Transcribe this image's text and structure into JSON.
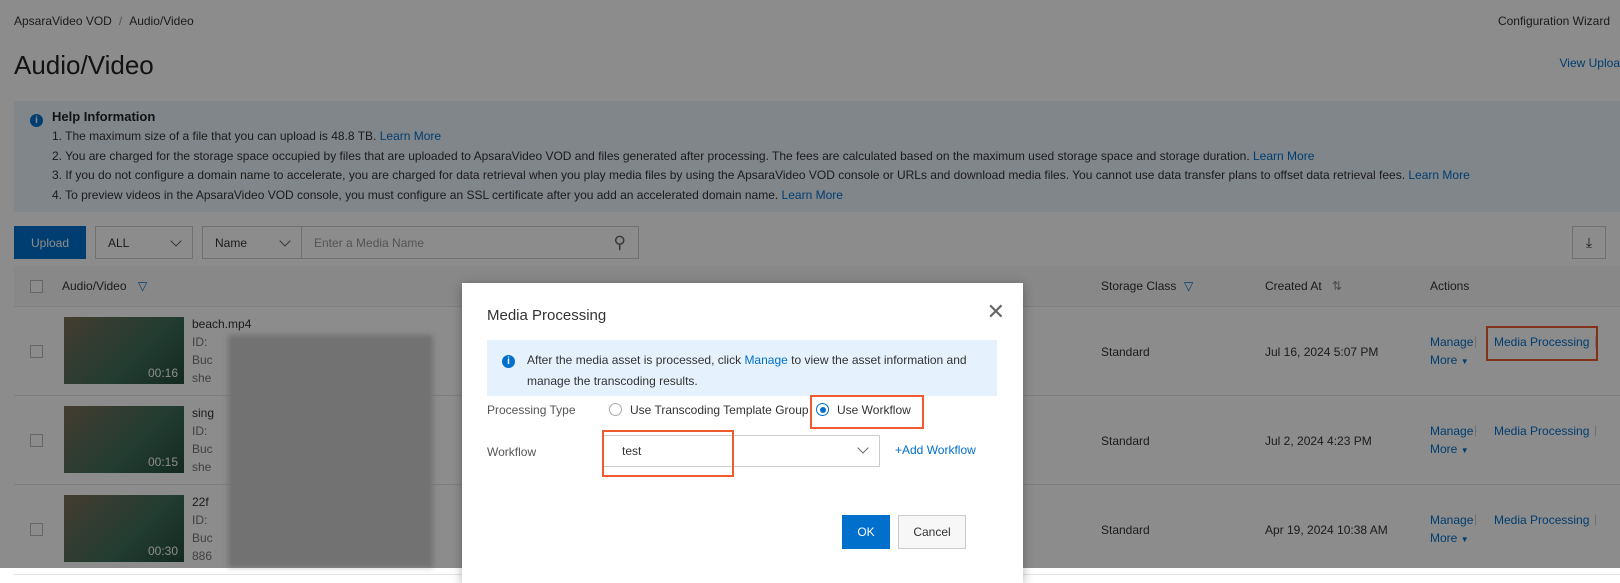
{
  "breadcrumb": [
    "ApsaraVideo VOD",
    "Audio/Video"
  ],
  "header": {
    "title": "Audio/Video",
    "config_wizard": "Configuration Wizard",
    "view_upload": "View Uploa"
  },
  "help": {
    "title": "Help Information",
    "items": [
      {
        "text": "1. The maximum size of a file that you can upload is 48.8 TB. ",
        "link": "Learn More"
      },
      {
        "text": "2. You are charged for the storage space occupied by files that are uploaded to ApsaraVideo VOD and files generated after processing. The fees are calculated based on the maximum used storage space and storage duration. ",
        "link": "Learn More"
      },
      {
        "text": "3. If you do not configure a domain name to accelerate, you are charged for data retrieval when you play media files by using the ApsaraVideo VOD console or URLs and download media files. You cannot use data transfer plans to offset data retrieval fees. ",
        "link": "Learn More"
      },
      {
        "text": "4. To preview videos in the ApsaraVideo VOD console, you must configure an SSL certificate after you add an accelerated domain name. ",
        "link": "Learn More"
      }
    ]
  },
  "toolbar": {
    "upload": "Upload",
    "filter": "ALL",
    "search_field": "Name",
    "search_placeholder": "Enter a Media Name"
  },
  "table": {
    "headers": {
      "media": "Audio/Video",
      "storage": "Storage Class",
      "created": "Created At",
      "actions": "Actions"
    },
    "rows": [
      {
        "name": "beach.mp4",
        "id": "ID:",
        "bucket": "Buc",
        "region": "she",
        "duration": "00:16",
        "storage": "Standard",
        "created": "Jul 16, 2024 5:07 PM",
        "manage": "Manage",
        "more": "More",
        "process": "Media Processing"
      },
      {
        "name": "sing",
        "id": "ID:",
        "bucket": "Buc",
        "region": "she",
        "duration": "00:15",
        "storage": "Standard",
        "created": "Jul 2, 2024 4:23 PM",
        "manage": "Manage",
        "more": "More",
        "process": "Media Processing"
      },
      {
        "name": "22f",
        "id": "ID:",
        "bucket": "Buc",
        "region": "886",
        "duration": "00:30",
        "storage": "Standard",
        "created": "Apr 19, 2024 10:38 AM",
        "manage": "Manage",
        "more": "More",
        "process": "Media Processing"
      }
    ]
  },
  "dialog": {
    "title": "Media Processing",
    "info_pre": "After the media asset is processed, click ",
    "info_link": "Manage",
    "info_post": " to view the asset information and manage the transcoding results.",
    "processing_type_label": "Processing Type",
    "option_template": "Use Transcoding Template Group",
    "option_workflow": "Use Workflow",
    "selected": "Use Workflow",
    "workflow_label": "Workflow",
    "workflow_value": "test",
    "add_workflow": "+Add Workflow",
    "ok": "OK",
    "cancel": "Cancel"
  },
  "colors": {
    "primary": "#0070cc",
    "highlight": "#f05a31"
  }
}
